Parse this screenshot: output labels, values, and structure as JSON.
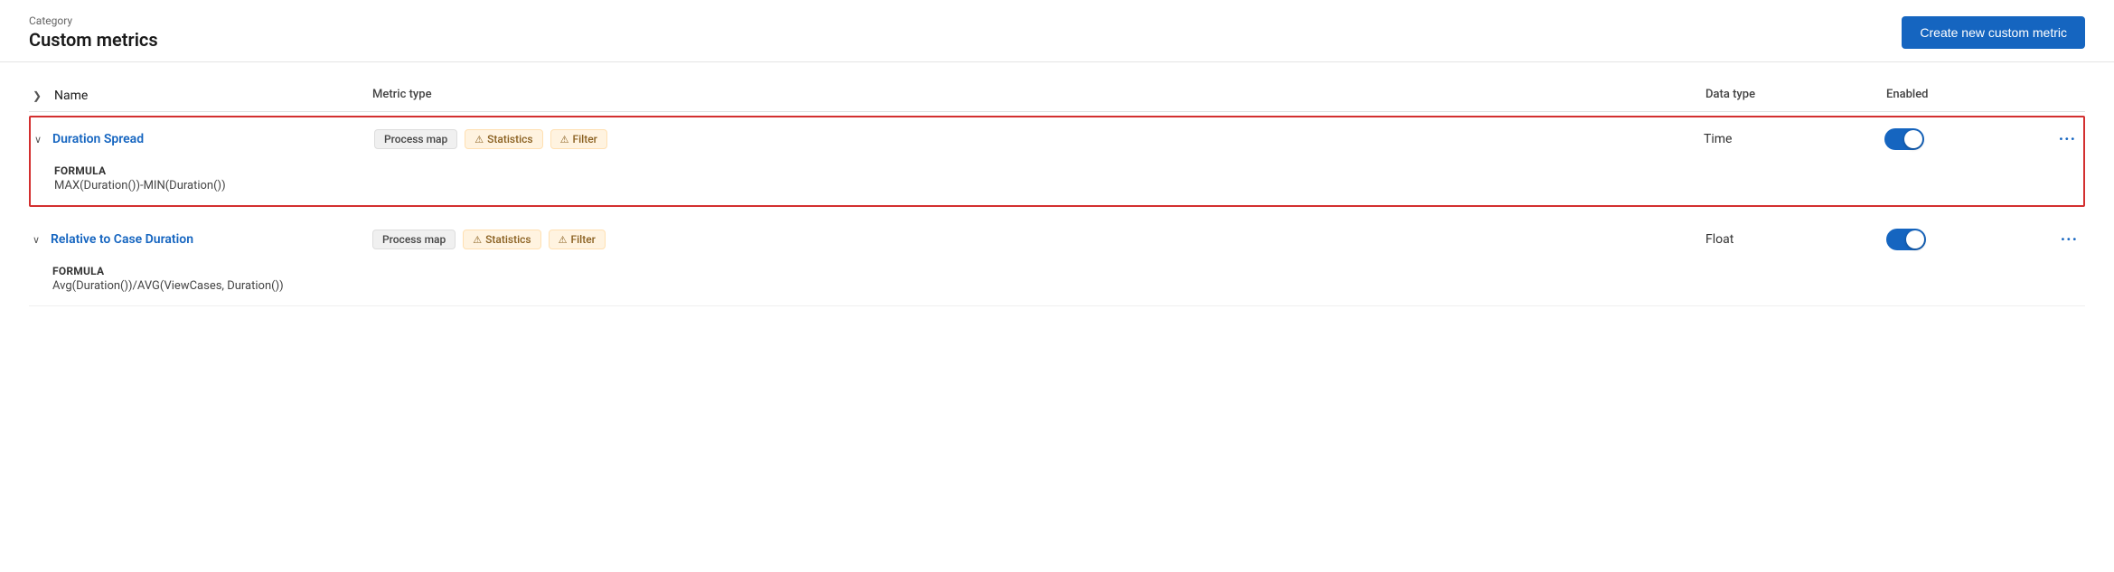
{
  "header": {
    "category_label": "Category",
    "page_title": "Custom metrics",
    "create_button_label": "Create new custom metric"
  },
  "table": {
    "columns": {
      "name": "Name",
      "metric_type": "Metric type",
      "data_type": "Data type",
      "enabled": "Enabled"
    },
    "rows": [
      {
        "id": "duration-spread",
        "name": "Duration Spread",
        "expanded": true,
        "highlighted": true,
        "badges": [
          {
            "label": "Process map",
            "type": "grey"
          },
          {
            "label": "Statistics",
            "type": "warning"
          },
          {
            "label": "Filter",
            "type": "warning"
          }
        ],
        "data_type": "Time",
        "enabled": true,
        "formula_label": "FORMULA",
        "formula_value": "MAX(Duration())-MIN(Duration())"
      },
      {
        "id": "relative-case-duration",
        "name": "Relative to Case Duration",
        "expanded": true,
        "highlighted": false,
        "badges": [
          {
            "label": "Process map",
            "type": "grey"
          },
          {
            "label": "Statistics",
            "type": "warning"
          },
          {
            "label": "Filter",
            "type": "warning"
          }
        ],
        "data_type": "Float",
        "enabled": true,
        "formula_label": "FORMULA",
        "formula_value": "Avg(Duration())/AVG(ViewCases, Duration())"
      }
    ]
  }
}
